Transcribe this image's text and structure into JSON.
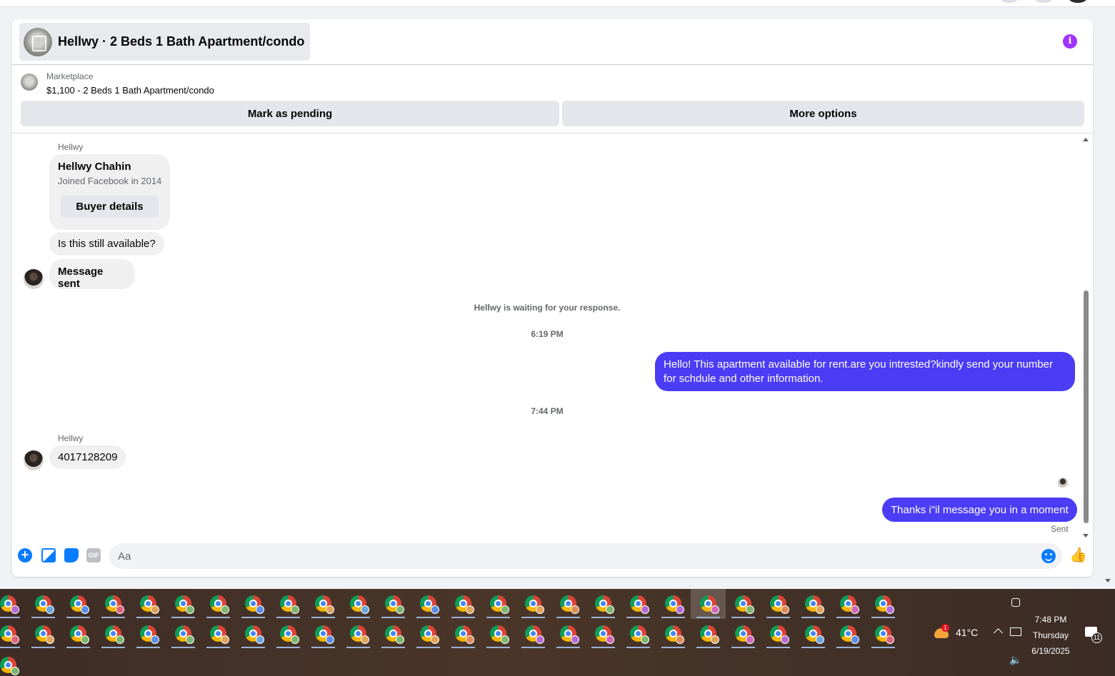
{
  "header": {
    "title": "Hellwy · 2 Beds 1 Bath Apartment/condo"
  },
  "listing": {
    "source_label": "Marketplace",
    "price_title": "$1,100 - 2 Beds 1 Bath Apartment/condo",
    "mark_pending_label": "Mark as pending",
    "more_options_label": "More options"
  },
  "conversation": {
    "first_sender": "Hellwy",
    "profile_name": "Hellwy Chahin",
    "profile_joined": "Joined Facebook in 2014",
    "buyer_details_label": "Buyer details",
    "msg_available": "Is this still available?",
    "msg_sent_notice": "Message sent",
    "waiting_note": "Hellwy is waiting for your response.",
    "time_1": "6:19 PM",
    "outgoing_1": "Hello! This apartment available for rent.are you intrested?kindly send your number for schdule and other information.",
    "time_2": "7:44 PM",
    "second_sender": "Hellwy",
    "incoming_number": "4017128209",
    "outgoing_2": "Thanks i\"il message you in a moment",
    "status": "Sent"
  },
  "composer": {
    "placeholder": "Aa",
    "gif_label": "GIF"
  },
  "taskbar": {
    "weather_temp": "41°C",
    "weather_alert_count": "1",
    "time": "7:48 PM",
    "day": "Thursday",
    "date": "6/19/2025",
    "notification_count": "11"
  },
  "colors": {
    "outgoing_bubble": "#4b3cf5",
    "accent_blue": "#0a7cff",
    "info_purple": "#a033ff"
  }
}
